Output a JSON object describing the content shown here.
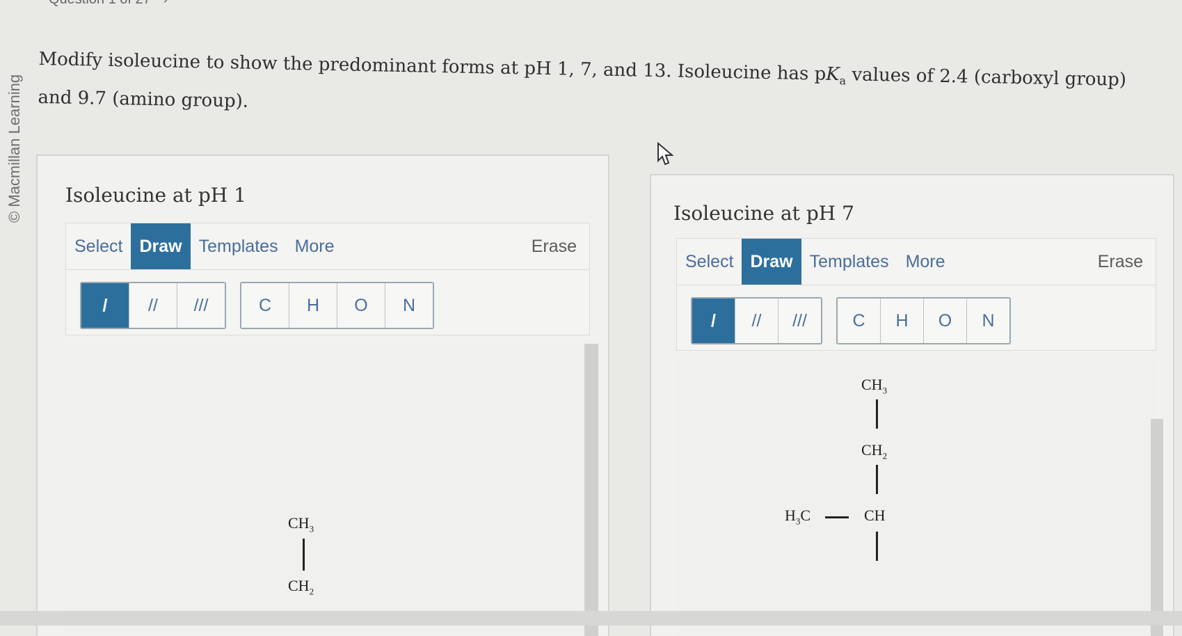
{
  "top": {
    "question_nav": "Question 1 of 27",
    "next_icon": "chevron-right-icon"
  },
  "brand": "© Macmillan Learning",
  "question": {
    "text_before": "Modify isoleucine to show the predominant forms at pH 1, 7, and 13. Isoleucine has p",
    "italic": "K",
    "sub": "a",
    "text_after": " values of 2.4 (carboxyl group) and 9.7 (amino group)."
  },
  "panels": [
    {
      "title": "Isoleucine at pH 1",
      "tabs": [
        "Select",
        "Draw",
        "Templates",
        "More"
      ],
      "erase": "Erase",
      "bonds": [
        "/",
        "//",
        "///"
      ],
      "atoms": [
        "C",
        "H",
        "O",
        "N"
      ],
      "structure": {
        "ch3": {
          "main": "CH",
          "sub": "3"
        },
        "ch2": {
          "main": "CH",
          "sub": "2"
        }
      }
    },
    {
      "title": "Isoleucine at pH 7",
      "tabs": [
        "Select",
        "Draw",
        "Templates",
        "More"
      ],
      "erase": "Erase",
      "bonds": [
        "/",
        "//",
        "///"
      ],
      "atoms": [
        "C",
        "H",
        "O",
        "N"
      ],
      "structure": {
        "ch3": {
          "main": "CH",
          "sub": "3"
        },
        "ch2": {
          "main": "CH",
          "sub": "2"
        },
        "h3c": {
          "main": "H",
          "sub": "3",
          "tail": "C"
        },
        "ch": {
          "main": "CH"
        }
      }
    }
  ],
  "colors": {
    "accent": "#2d6f9c",
    "tab_text": "#4a6d9c"
  }
}
